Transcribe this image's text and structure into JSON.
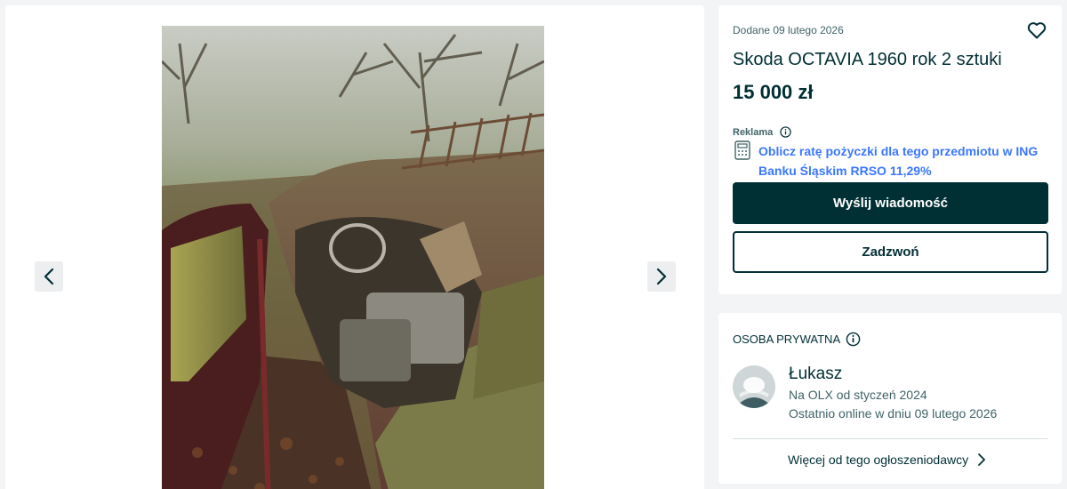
{
  "gallery": {
    "photo_alt": "",
    "icons": {
      "prev": "chevron-left-icon",
      "next": "chevron-right-icon"
    }
  },
  "listing": {
    "posted": "Dodane 09 lutego 2026",
    "title": "Skoda OCTAVIA 1960 rok 2 sztuki",
    "price": "15 000 zł",
    "favorite_icon": "heart-icon",
    "ad_label": "Reklama",
    "loan_offer": "Oblicz ratę pożyczki dla tego przedmiotu w ING Banku Śląskim RRSO 11,29%",
    "message_button": "Wyślij wiadomość",
    "call_button": "Zadzwoń"
  },
  "seller": {
    "type": "OSOBA PRYWATNA",
    "name": "Łukasz",
    "member_since": "Na OLX od styczeń 2024",
    "last_online": "Ostatnio online w dniu 09 lutego 2026",
    "more_link": "Więcej od tego ogłoszeniodawcy"
  },
  "colors": {
    "brand_dark": "#002f34",
    "link_blue": "#3a77ff",
    "background": "#f2f4f5",
    "muted_text": "#406367"
  }
}
